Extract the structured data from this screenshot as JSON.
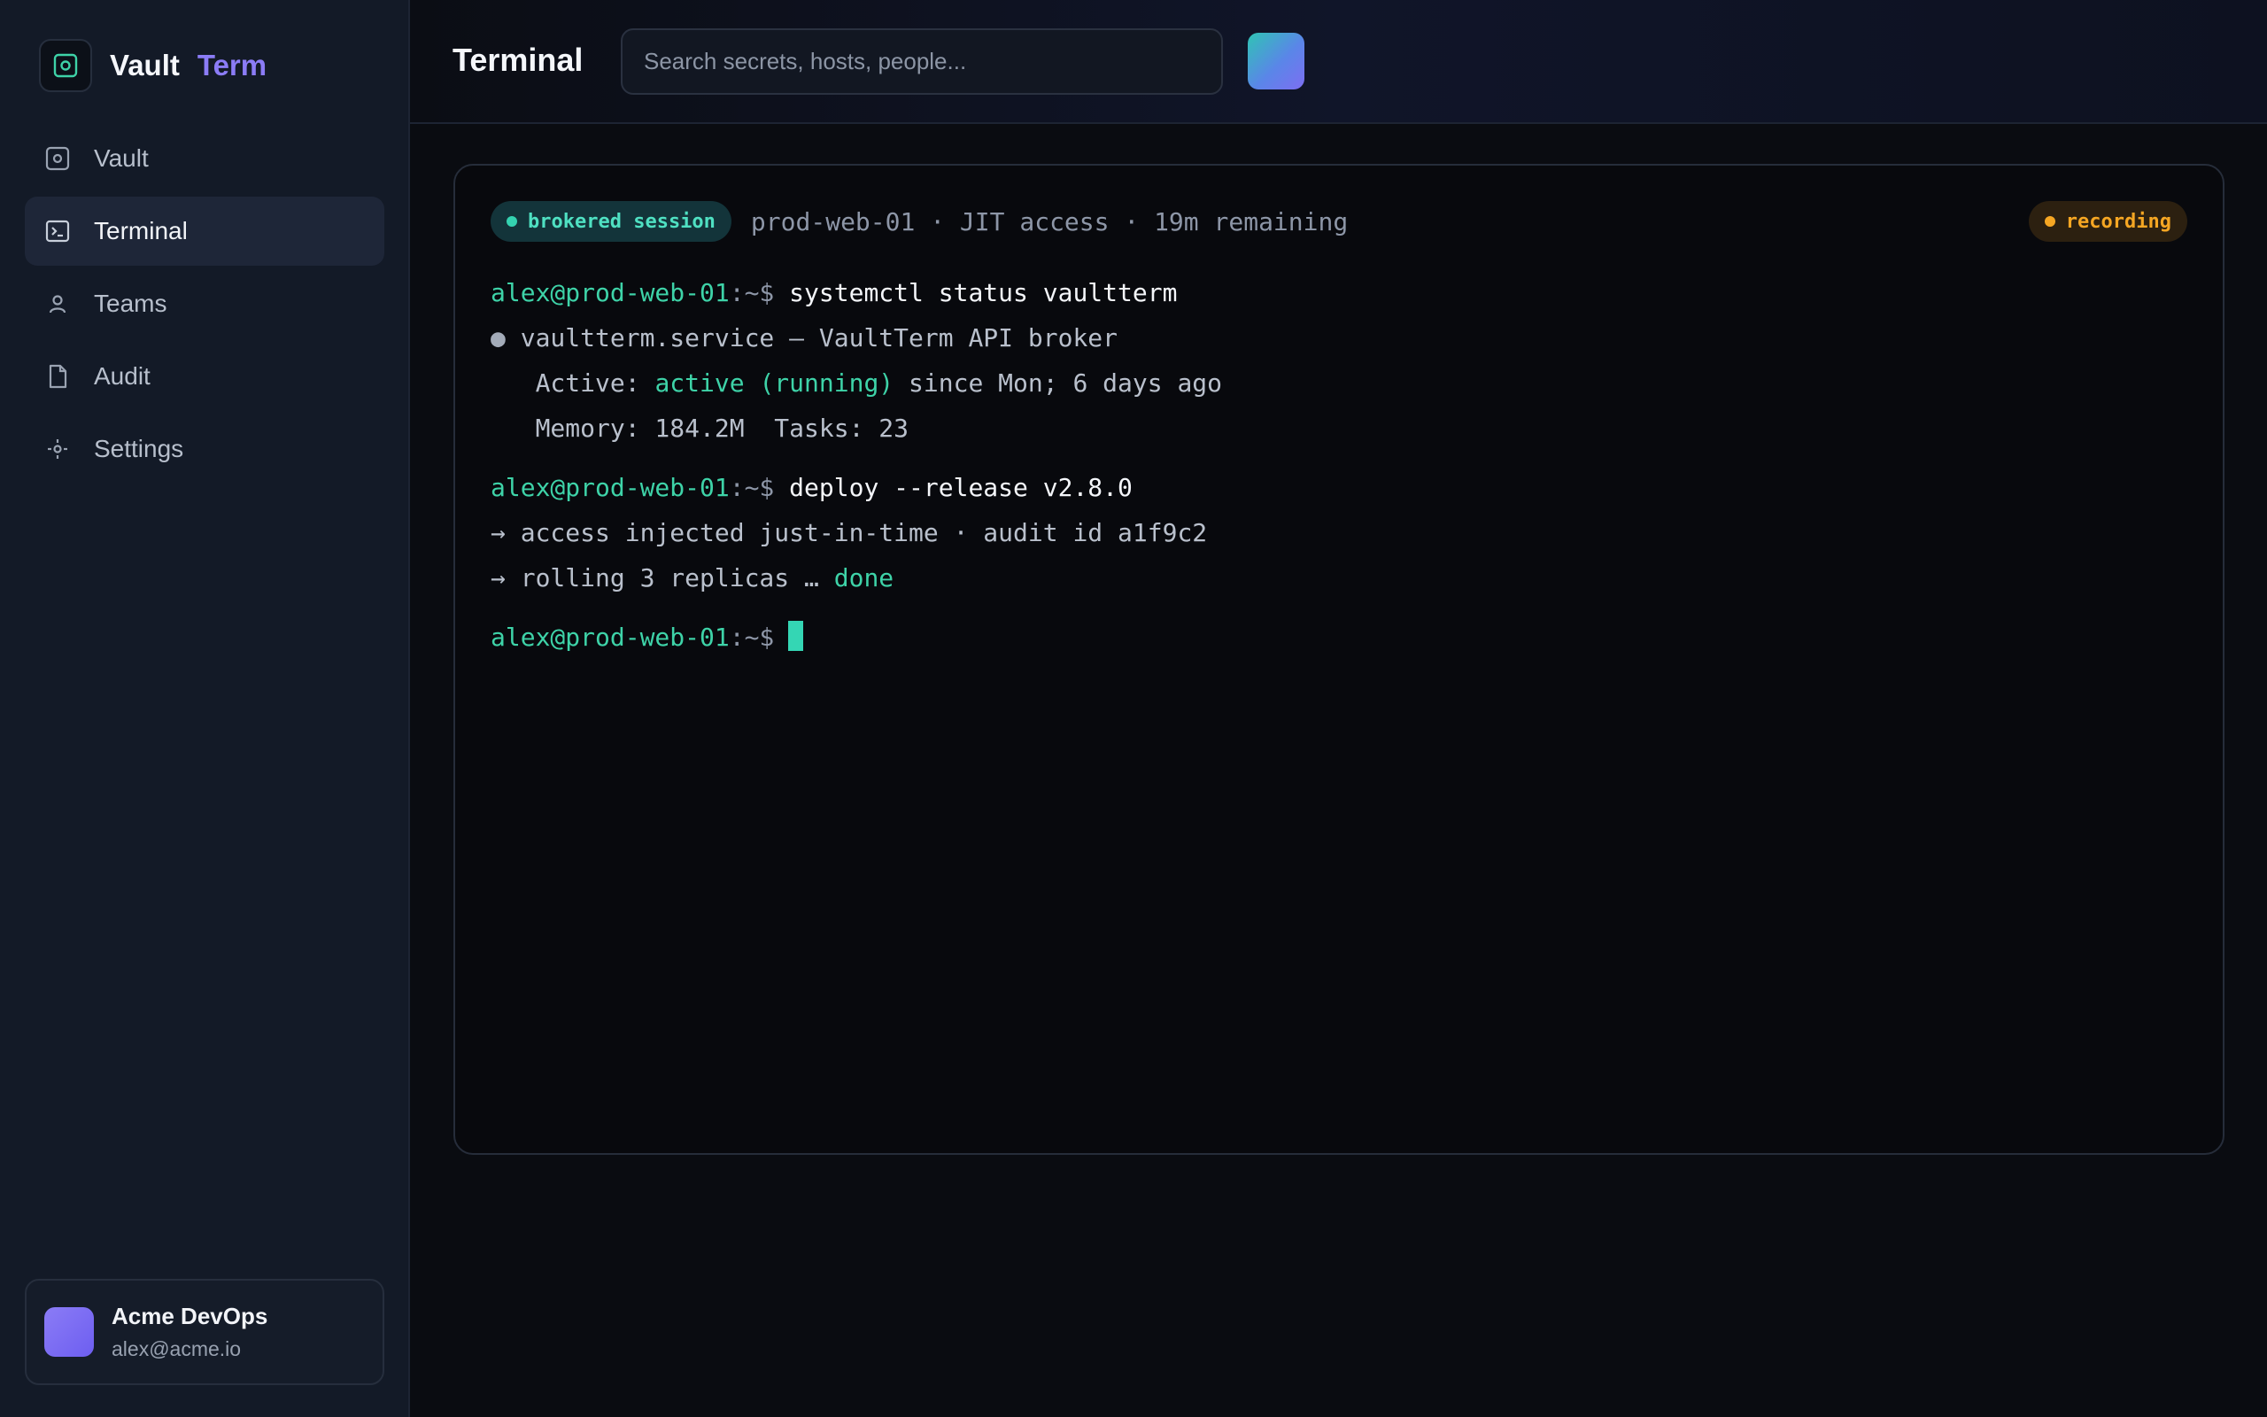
{
  "brand": {
    "name_part1": "Vault",
    "name_part2": "Term"
  },
  "sidebar": {
    "items": [
      {
        "label": "Vault",
        "icon": "vault-icon",
        "active": false
      },
      {
        "label": "Terminal",
        "icon": "terminal-icon",
        "active": true
      },
      {
        "label": "Teams",
        "icon": "person-icon",
        "active": false
      },
      {
        "label": "Audit",
        "icon": "document-icon",
        "active": false
      },
      {
        "label": "Settings",
        "icon": "gear-icon",
        "active": false
      }
    ],
    "account": {
      "name": "Acme DevOps",
      "email": "alex@acme.io"
    }
  },
  "header": {
    "title": "Terminal",
    "search_placeholder": "Search secrets, hosts, people..."
  },
  "terminal": {
    "session_badge": "brokered session",
    "session_info": "prod-web-01 · JIT access · 19m remaining",
    "recording_badge": "recording",
    "prompt_user": "alex@prod-web-01",
    "prompt_path": ":~$",
    "lines": {
      "cmd1": "systemctl status vaultterm",
      "out1_bullet": "●",
      "out1": " vaultterm.service — VaultTerm API broker",
      "out2_prefix": "   Active: ",
      "out2_status": "active (running)",
      "out2_suffix": " since Mon; 6 days ago",
      "out3": "   Memory: 184.2M  Tasks: 23",
      "cmd2": "deploy --release v2.8.0",
      "out4": "→ access injected just-in-time · audit id a1f9c2",
      "out5_prefix": "→ rolling 3 replicas … ",
      "out5_status": "done"
    }
  },
  "colors": {
    "accent_purple": "#8b7cf6",
    "accent_teal": "#3ed3a8",
    "recording_amber": "#f5a623",
    "background": "#0a0c11"
  }
}
